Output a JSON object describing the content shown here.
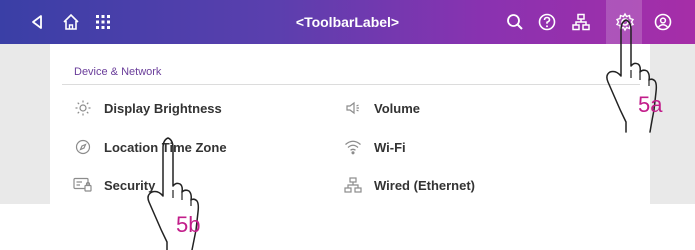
{
  "toolbar": {
    "label": "<ToolbarLabel>",
    "icons": [
      "back-icon",
      "home-icon",
      "apps-grid-icon",
      "search-icon",
      "help-icon",
      "network-icon",
      "settings-icon",
      "account-icon"
    ]
  },
  "section": {
    "title": "Device & Network"
  },
  "items": {
    "display_brightness": "Display Brightness",
    "volume": "Volume",
    "location_time_zone": "Location Time Zone",
    "wifi": "Wi-Fi",
    "security": "Security",
    "wired": "Wired (Ethernet)"
  },
  "callouts": {
    "a": "5a",
    "b": "5b"
  },
  "colors": {
    "toolbar_start": "#3a3fa6",
    "toolbar_end": "#a62ea8",
    "accent": "#6a3d9a",
    "callout": "#c21d8a"
  }
}
